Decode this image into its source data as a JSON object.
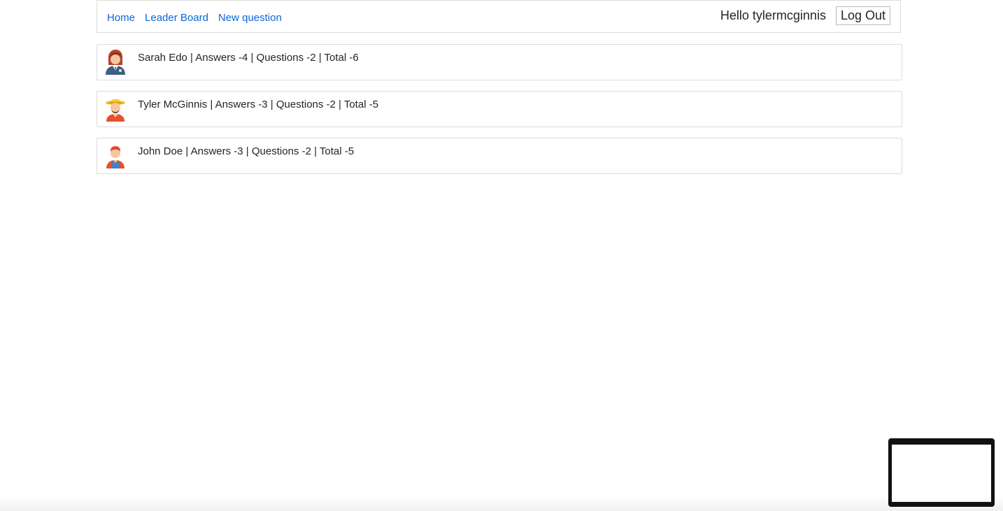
{
  "nav": {
    "links": [
      "Home",
      "Leader Board",
      "New question"
    ],
    "greeting": "Hello tylermcginnis",
    "logout_label": "Log Out",
    "link_color": "#0a66d8"
  },
  "leaderboard": [
    {
      "avatar": "woman-avatar-icon",
      "text": "Sarah Edo | Answers -4 | Questions -2 | Total -6"
    },
    {
      "avatar": "man-with-hat-avatar-icon",
      "text": "Tyler McGinnis | Answers -3 | Questions -2 | Total -5"
    },
    {
      "avatar": "man-avatar-icon",
      "text": "John Doe | Answers -3 | Questions -2 | Total -5"
    }
  ]
}
